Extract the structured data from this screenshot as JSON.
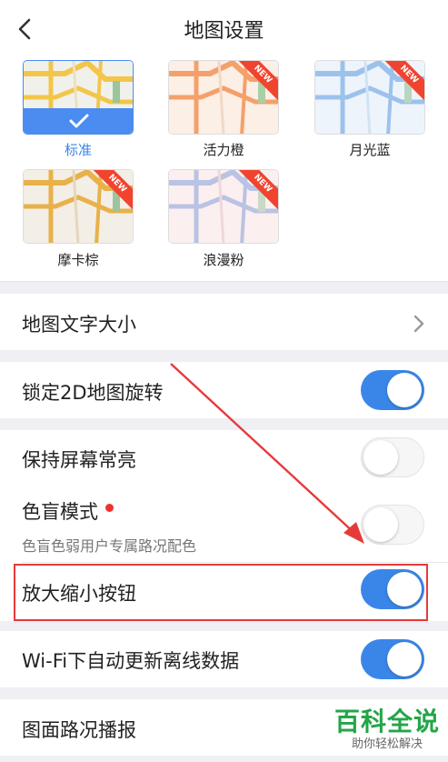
{
  "header": {
    "title": "地图设置",
    "back_icon": "chevron-left-icon"
  },
  "themes": {
    "items": [
      {
        "label": "标准",
        "selected": true,
        "new": false,
        "palette": "#f3c64a"
      },
      {
        "label": "活力橙",
        "selected": false,
        "new": true,
        "palette": "#f5a06a"
      },
      {
        "label": "月光蓝",
        "selected": false,
        "new": true,
        "palette": "#9cc2ec"
      },
      {
        "label": "摩卡棕",
        "selected": false,
        "new": true,
        "palette": "#e8b14a"
      },
      {
        "label": "浪漫粉",
        "selected": false,
        "new": true,
        "palette": "#b9c3e3"
      }
    ],
    "new_badge": "NEW"
  },
  "settings": {
    "map_text_size": "地图文字大小",
    "lock_2d_rotation": {
      "label": "锁定2D地图旋转",
      "on": true
    },
    "keep_screen_on": {
      "label": "保持屏幕常亮",
      "on": false
    },
    "color_blind_mode": {
      "label": "色盲模式",
      "sub": "色盲色弱用户专属路况配色",
      "on": false
    },
    "zoom_buttons": {
      "label": "放大缩小按钮",
      "on": true
    },
    "wifi_auto_update": {
      "label": "Wi-Fi下自动更新离线数据",
      "on": true
    },
    "traffic_broadcast": {
      "label": "图面路况播报"
    }
  },
  "watermark": {
    "main": "百科全说",
    "sub": "助你轻松解决"
  },
  "colors": {
    "accent": "#3a86e8",
    "highlight": "#e63a3a",
    "red_dot": "#f0302e"
  }
}
